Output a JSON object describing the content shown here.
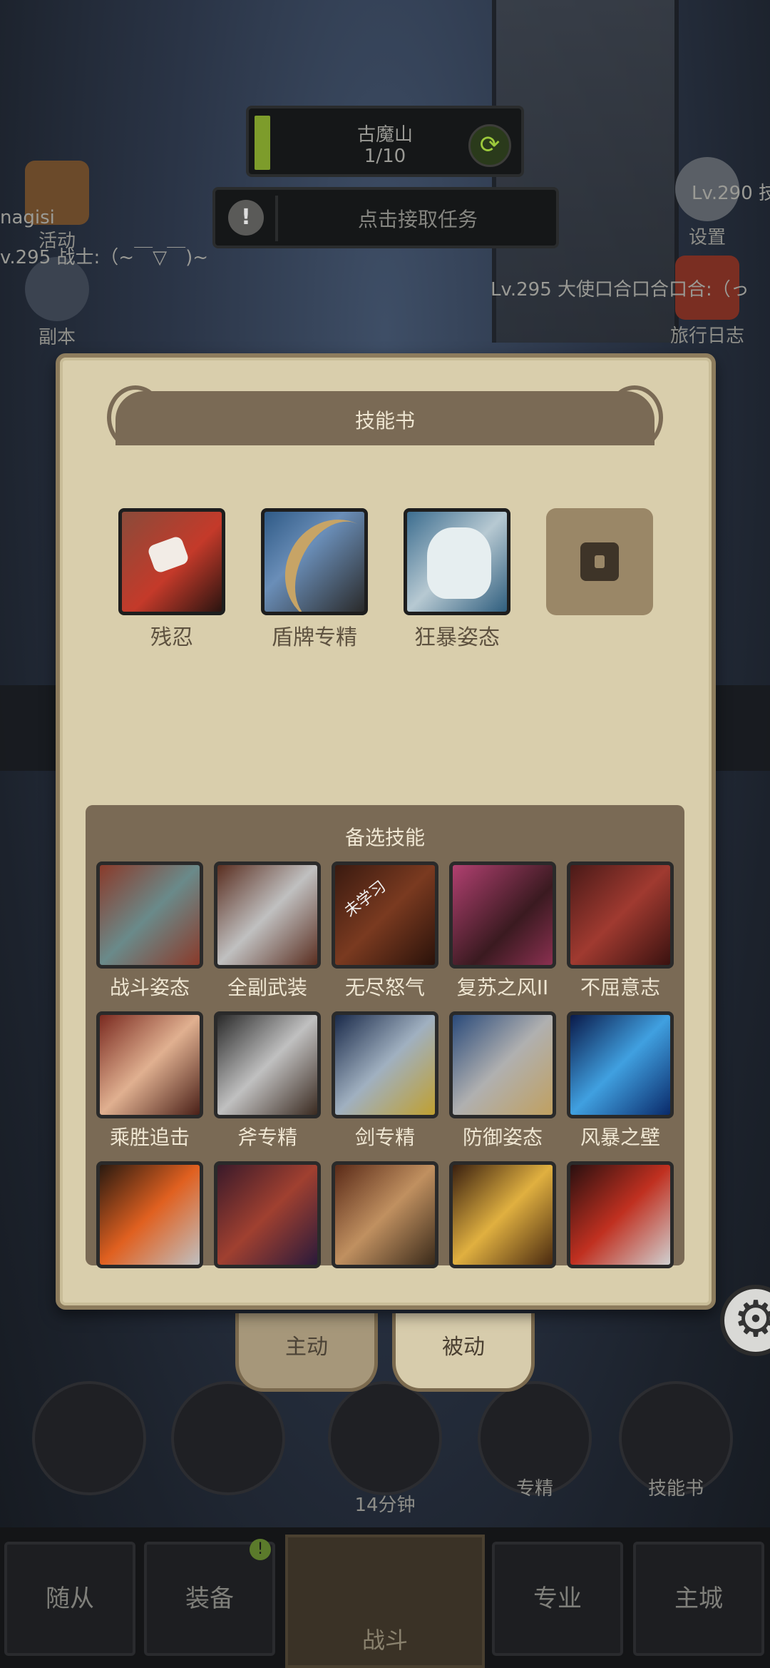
{
  "hud": {
    "map_name": "古魔山",
    "map_progress": "1/10",
    "task_label": "点击接取任务"
  },
  "side_left": [
    {
      "label": "活动"
    },
    {
      "label": "副本"
    }
  ],
  "side_right": [
    {
      "label": "设置"
    },
    {
      "label": "旅行日志"
    }
  ],
  "chat": {
    "line1": "nagisi",
    "line2": "v.295 战士:（~￣▽￣)~",
    "line3": "Lv.290 技",
    "line4": "Lv.295 大使口合口合口合:（っ"
  },
  "panel": {
    "title": "技能书",
    "equipped": [
      {
        "label": "残忍",
        "icon": "cruelty-icon"
      },
      {
        "label": "盾牌专精",
        "icon": "shield-mastery-icon"
      },
      {
        "label": "狂暴姿态",
        "icon": "berserk-stance-icon"
      }
    ],
    "locked_slot_icon": "lock-icon",
    "alternatives_title": "备选技能",
    "unlearned_tag": "未学习",
    "alternatives": [
      {
        "label": "战斗姿态"
      },
      {
        "label": "全副武装"
      },
      {
        "label": "无尽怒气"
      },
      {
        "label": "复苏之风II"
      },
      {
        "label": "不屈意志"
      },
      {
        "label": "乘胜追击"
      },
      {
        "label": "斧专精"
      },
      {
        "label": "剑专精"
      },
      {
        "label": "防御姿态"
      },
      {
        "label": "风暴之壁"
      },
      {
        "label": ""
      },
      {
        "label": ""
      },
      {
        "label": ""
      },
      {
        "label": ""
      },
      {
        "label": ""
      }
    ]
  },
  "tabs": {
    "active": "主动",
    "passive": "被动"
  },
  "bottom": {
    "timer": "14分钟",
    "specialize": "专精",
    "skillbook": "技能书"
  },
  "nav": {
    "followers": "随从",
    "equipment": "装备",
    "battle": "战斗",
    "profession": "专业",
    "city": "主城",
    "equipment_badge": "!"
  }
}
